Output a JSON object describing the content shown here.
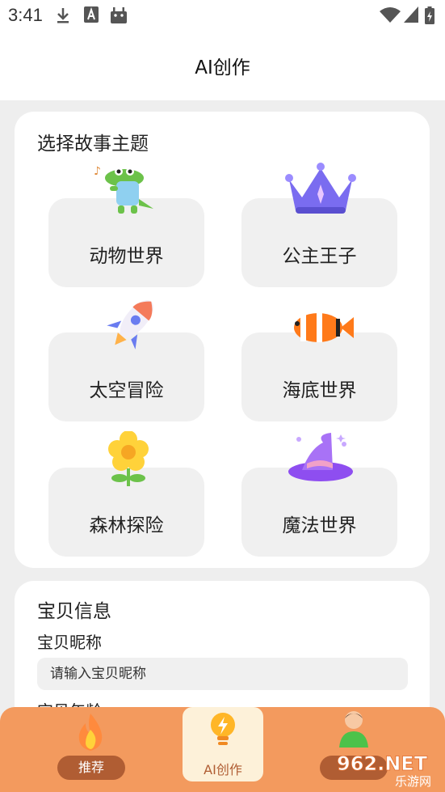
{
  "status": {
    "time": "3:41",
    "icons": [
      "download-icon",
      "a-letter-icon",
      "android-icon",
      "wifi-icon",
      "signal-icon",
      "battery-icon"
    ]
  },
  "header": {
    "title": "AI创作"
  },
  "themes": {
    "title": "选择故事主题",
    "items": [
      {
        "label": "动物世界",
        "icon": "crocodile-icon"
      },
      {
        "label": "公主王子",
        "icon": "crown-icon"
      },
      {
        "label": "太空冒险",
        "icon": "rocket-icon"
      },
      {
        "label": "海底世界",
        "icon": "clownfish-icon"
      },
      {
        "label": "森林探险",
        "icon": "flower-icon"
      },
      {
        "label": "魔法世界",
        "icon": "wizard-hat-icon"
      }
    ]
  },
  "baby": {
    "title": "宝贝信息",
    "nickname_label": "宝贝昵称",
    "nickname_placeholder": "请输入宝贝昵称",
    "age_label": "宝贝年龄"
  },
  "nav": {
    "items": [
      {
        "label": "推荐",
        "icon": "flame-icon"
      },
      {
        "label": "AI创作",
        "icon": "lightbulb-icon",
        "active": true
      },
      {
        "label": "",
        "icon": "person-icon"
      }
    ]
  },
  "watermark": {
    "text": "962.NET",
    "subtext": "乐游网"
  },
  "colors": {
    "accent": "#f39a5e",
    "nav_pill": "#b05d33",
    "active_tab_bg": "#fdf1d9",
    "tile_bg": "#f0f0f0",
    "page_bg": "#eeeeee"
  }
}
